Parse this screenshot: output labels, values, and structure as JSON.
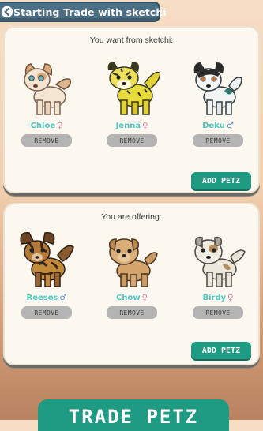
{
  "header": {
    "title": "Starting Trade with sketchi",
    "back_icon": "back-arrow-icon"
  },
  "want_panel": {
    "title": "You want from sketchi:",
    "pets": [
      {
        "name": "Chloe",
        "gender": "♀",
        "gender_type": "female",
        "remove_label": "REMOVE"
      },
      {
        "name": "Jenna",
        "gender": "♀",
        "gender_type": "female",
        "remove_label": "REMOVE"
      },
      {
        "name": "Deku",
        "gender": "♂",
        "gender_type": "male",
        "remove_label": "REMOVE"
      }
    ],
    "add_label": "ADD PETZ"
  },
  "offer_panel": {
    "title": "You are offering:",
    "pets": [
      {
        "name": "Reeses",
        "gender": "♂",
        "gender_type": "male",
        "remove_label": "REMOVE"
      },
      {
        "name": "Chow",
        "gender": "♀",
        "gender_type": "female",
        "remove_label": "REMOVE"
      },
      {
        "name": "Birdy",
        "gender": "♀",
        "gender_type": "female",
        "remove_label": "REMOVE"
      }
    ],
    "add_label": "ADD PETZ"
  },
  "footer": {
    "trade_label": "TRADE PETZ"
  },
  "colors": {
    "accent": "#1f9a83",
    "header": "#4b6f86",
    "name": "#4ec7c0",
    "remove": "#b4b4b4"
  }
}
